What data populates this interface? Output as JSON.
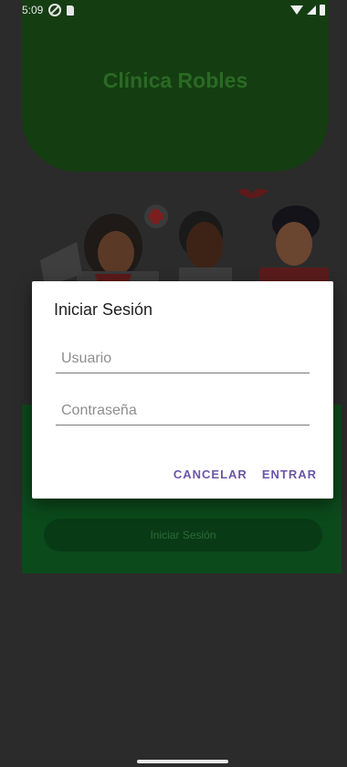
{
  "status_bar": {
    "time": "5:09"
  },
  "background": {
    "clinic_title": "Clínica Robles",
    "login_button_label": "Iniciar Sesión"
  },
  "dialog": {
    "title": "Iniciar Sesión",
    "username_placeholder": "Usuario",
    "password_placeholder": "Contraseña",
    "username_value": "",
    "password_value": "",
    "cancel_label": "CANCELAR",
    "enter_label": "ENTRAR"
  },
  "colors": {
    "header_green": "#153d12",
    "panel_green": "#0b4a1b",
    "dialog_bg": "#ffffff",
    "button_accent": "#6a56a8",
    "overlay": "#2b2b2b"
  }
}
